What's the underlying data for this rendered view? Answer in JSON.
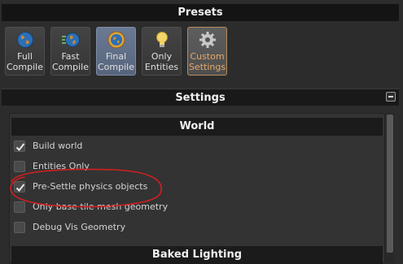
{
  "presets": {
    "header": "Presets",
    "items": [
      {
        "line1": "Full",
        "line2": "Compile",
        "icon": "globe-icon"
      },
      {
        "line1": "Fast",
        "line2": "Compile",
        "icon": "fast-globe-icon"
      },
      {
        "line1": "Final",
        "line2": "Compile",
        "icon": "gold-globe-icon"
      },
      {
        "line1": "Only",
        "line2": "Entities",
        "icon": "lightbulb-icon"
      },
      {
        "line1": "Custom",
        "line2": "Settings",
        "icon": "gear-icon"
      }
    ],
    "selected": "Final Compile",
    "custom_color": "#e6a86a"
  },
  "settings": {
    "header": "Settings",
    "world": {
      "title": "World",
      "options": [
        {
          "label": "Build world",
          "checked": true
        },
        {
          "label": "Entities Only",
          "checked": false
        },
        {
          "label": "Pre-Settle physics objects",
          "checked": true
        },
        {
          "label": "Only base tile mesh geometry",
          "checked": false
        },
        {
          "label": "Debug Vis Geometry",
          "checked": false
        }
      ]
    },
    "baked_lighting": {
      "title": "Baked Lighting"
    }
  },
  "annotation": {
    "color": "#d21f1f",
    "target": "Pre-Settle physics objects"
  }
}
